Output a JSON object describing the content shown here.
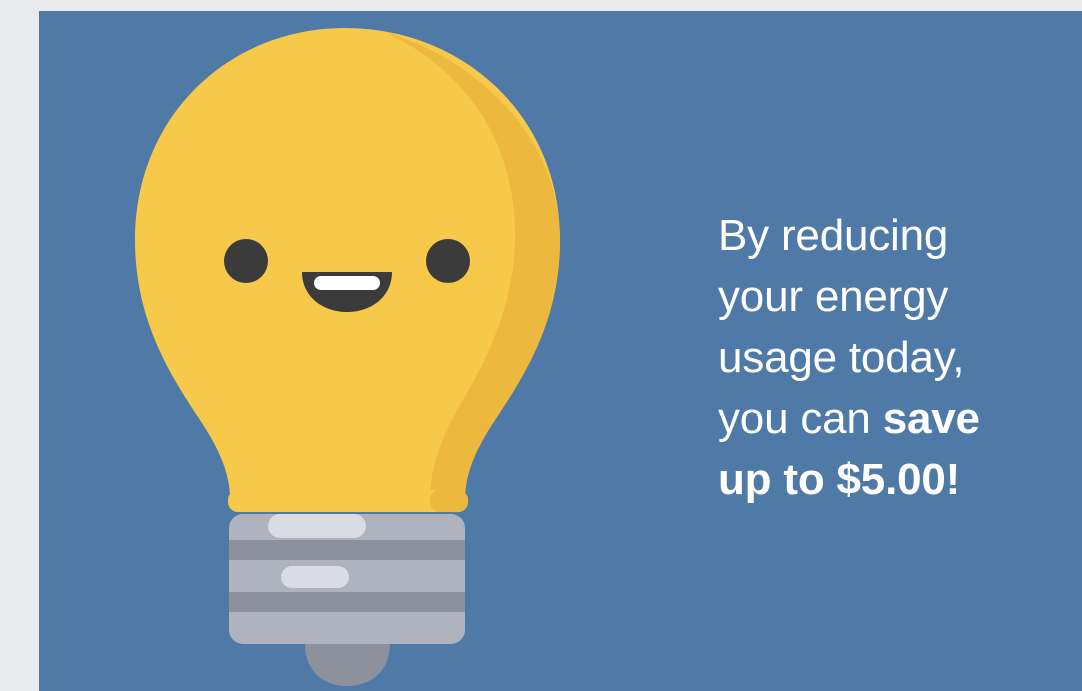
{
  "promo": {
    "line1": "By reducing",
    "line2": "your energy",
    "line3": "usage today,",
    "line4_regular": "you can ",
    "line4_bold": "save",
    "line5_bold": "up to $5.00!"
  },
  "illustration": {
    "icon": "smiling-lightbulb-icon"
  },
  "colors": {
    "background": "#4f79a6",
    "bulb_glass": "#f6c94a",
    "bulb_shade": "#edb83e",
    "screw_base": "#aeb3be",
    "screw_groove": "#8c919c",
    "face": "#3b3b3b",
    "text": "#ffffff"
  }
}
